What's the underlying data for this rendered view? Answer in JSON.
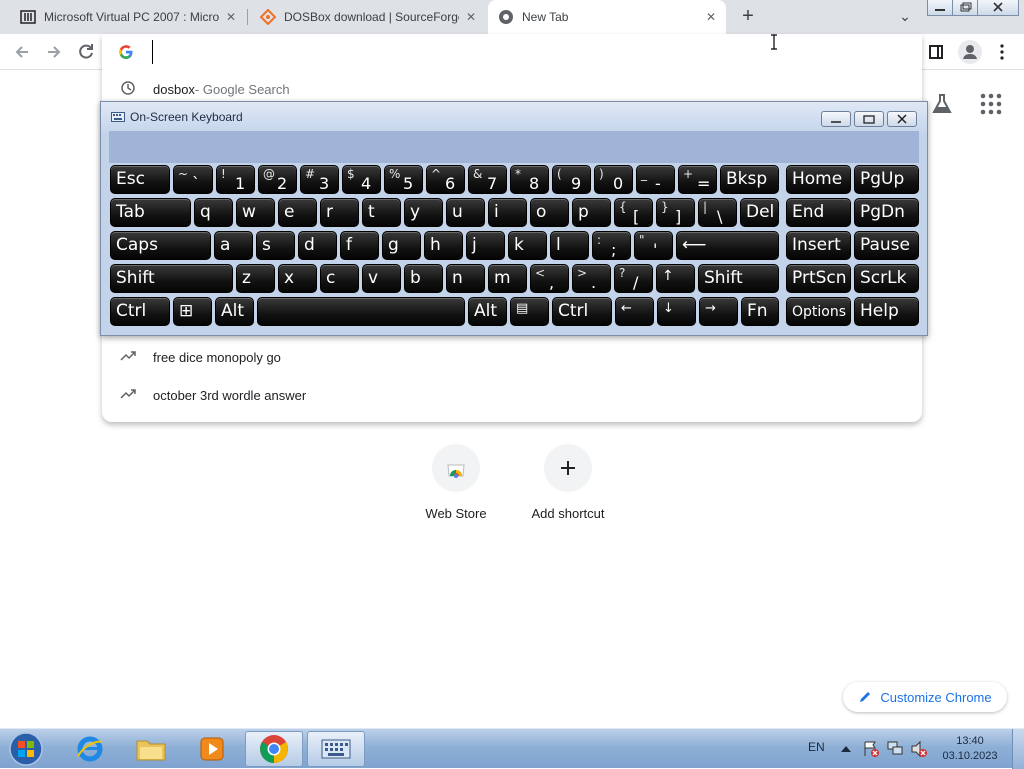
{
  "browser": {
    "tabs": [
      {
        "title": "Microsoft Virtual PC 2007 : Micro",
        "icon": "archive-icon"
      },
      {
        "title": "DOSBox download | SourceForge",
        "icon": "sourceforge-icon"
      },
      {
        "title": "New Tab",
        "icon": "chrome-icon",
        "active": true
      }
    ],
    "new_tab_symbol": "+",
    "tab_list_symbol": "⌄",
    "close_symbol": "✕"
  },
  "omnibox": {
    "value": "",
    "suggestions": [
      {
        "text": "dosbox",
        "sub": " - Google Search",
        "icon": "history-icon"
      },
      {
        "text": "free dice monopoly go",
        "sub": "",
        "icon": "trending-icon"
      },
      {
        "text": "october 3rd wordle answer",
        "sub": "",
        "icon": "trending-icon"
      }
    ]
  },
  "ntp": {
    "shortcuts": [
      {
        "label": "Web Store",
        "icon": "webstore-icon"
      },
      {
        "label": "Add shortcut",
        "icon": "plus-icon"
      }
    ],
    "customize_label": "Customize Chrome"
  },
  "osk": {
    "title": "On-Screen Keyboard",
    "keys": {
      "esc": "Esc",
      "grave": [
        "~",
        "`"
      ],
      "d1": [
        "!",
        "1"
      ],
      "d2": [
        "@",
        "2"
      ],
      "d3": [
        "#",
        "3"
      ],
      "d4": [
        "$",
        "4"
      ],
      "d5": [
        "%",
        "5"
      ],
      "d6": [
        "^",
        "6"
      ],
      "d7": [
        "&",
        "7"
      ],
      "d8": [
        "*",
        "8"
      ],
      "d9": [
        "(",
        "9"
      ],
      "d0": [
        ")",
        "0"
      ],
      "minus": [
        "_",
        "-"
      ],
      "equals": [
        "+",
        "="
      ],
      "bksp": "Bksp",
      "home": "Home",
      "pgup": "PgUp",
      "tab": "Tab",
      "q": "q",
      "w": "w",
      "e": "e",
      "r": "r",
      "t": "t",
      "y": "y",
      "u": "u",
      "i": "i",
      "o": "o",
      "p": "p",
      "lbracket": [
        "{",
        "["
      ],
      "rbracket": [
        "}",
        "]"
      ],
      "backslash": [
        "|",
        "\\"
      ],
      "del": "Del",
      "end": "End",
      "pgdn": "PgDn",
      "caps": "Caps",
      "a": "a",
      "s": "s",
      "d": "d",
      "f": "f",
      "g": "g",
      "h": "h",
      "j": "j",
      "k": "k",
      "l": "l",
      "semicolon": [
        ":",
        ";"
      ],
      "quote": [
        "\"",
        "'"
      ],
      "enter": "⟵",
      "insert": "Insert",
      "pause": "Pause",
      "lshift": "Shift",
      "z": "z",
      "x": "x",
      "c": "c",
      "v": "v",
      "b": "b",
      "n": "n",
      "m": "m",
      "comma": [
        "<",
        ","
      ],
      "period": [
        ">",
        "."
      ],
      "slash": [
        "?",
        "/"
      ],
      "up": "↑",
      "rshift": "Shift",
      "prtscn": "PrtScn",
      "scrlk": "ScrLk",
      "lctrl": "Ctrl",
      "win": "⊞",
      "lalt": "Alt",
      "space": "",
      "ralt": "Alt",
      "menu": "▤",
      "rctrl": "Ctrl",
      "left": "←",
      "down": "↓",
      "right": "→",
      "fn": "Fn",
      "options": "Options",
      "help": "Help"
    }
  },
  "taskbar": {
    "lang": "EN",
    "time": "13:40",
    "date": "03.10.2023"
  }
}
